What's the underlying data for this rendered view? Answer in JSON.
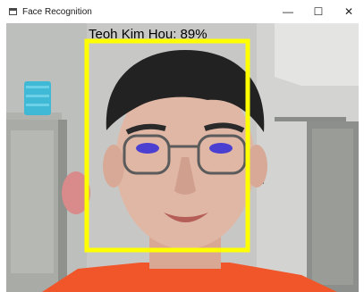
{
  "window": {
    "title": "Face Recognition",
    "minimize_glyph": "—",
    "maximize_glyph": "☐",
    "close_glyph": "✕"
  },
  "detection": {
    "label": "Teoh Kim Hou: 89%",
    "name": "Teoh Kim Hou",
    "confidence_percent": 89,
    "box_color": "#ffff00"
  },
  "colors": {
    "box": "#ffff00",
    "label_text": "#000000"
  }
}
